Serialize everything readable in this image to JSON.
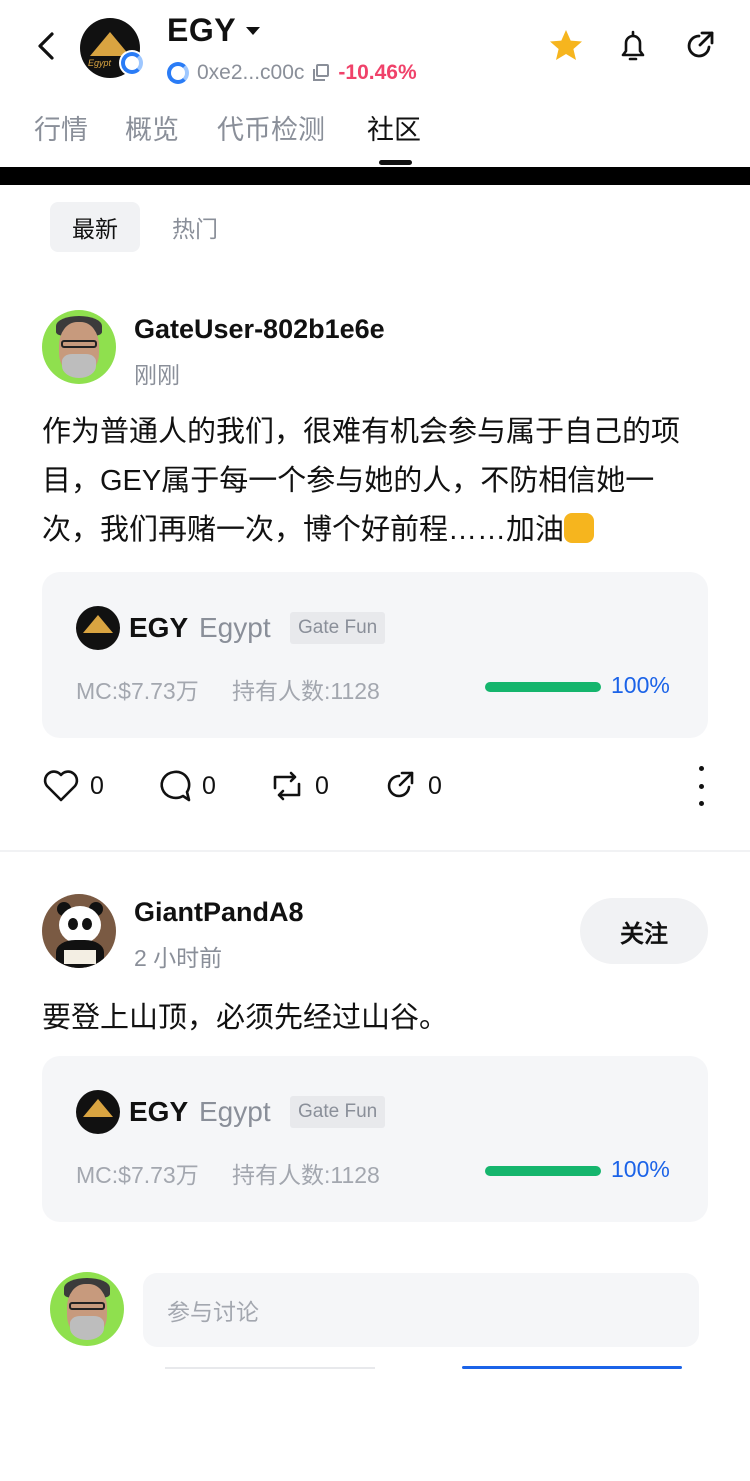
{
  "header": {
    "title": "EGY",
    "address": "0xe2...c00c",
    "change": "-10.46%",
    "colors": {
      "star": "#f6b51e",
      "negative": "#f0426a",
      "chain": "#2a7cf6"
    }
  },
  "tabs": [
    {
      "label": "行情"
    },
    {
      "label": "概览"
    },
    {
      "label": "代币检测"
    },
    {
      "label": "社区"
    }
  ],
  "filters": [
    {
      "label": "最新"
    },
    {
      "label": "热门"
    }
  ],
  "posts": [
    {
      "username": "GateUser-802b1e6e",
      "time": "刚刚",
      "content": "作为普通人的我们，很难有机会参与属于自己的项目，GEY属于每一个参与她的人，不防相信她一次，我们再赌一次，博个好前程……加油",
      "token": {
        "symbol": "EGY",
        "name": "Egypt",
        "tag": "Gate Fun",
        "mc": "MC:$7.73万",
        "holders": "持有人数:1128",
        "progress_label": "100%",
        "progress": 1.0
      },
      "actions": {
        "likes": "0",
        "comments": "0",
        "reposts": "0",
        "shares": "0"
      }
    },
    {
      "username": "GiantPandA8",
      "time": "2 小时前",
      "follow_label": "关注",
      "content": "要登上山顶，必须先经过山谷。",
      "token": {
        "symbol": "EGY",
        "name": "Egypt",
        "tag": "Gate Fun",
        "mc": "MC:$7.73万",
        "holders": "持有人数:1128",
        "progress_label": "100%",
        "progress": 1.0
      }
    }
  ],
  "composer": {
    "placeholder": "参与讨论"
  }
}
